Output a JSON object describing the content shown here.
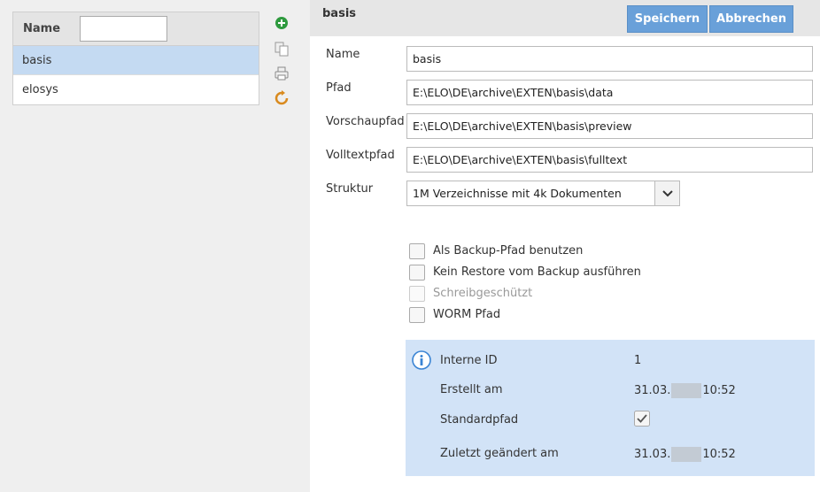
{
  "list": {
    "header_label": "Name",
    "filter_value": "",
    "rows": [
      {
        "label": "basis",
        "selected": true
      },
      {
        "label": "elosys",
        "selected": false
      }
    ]
  },
  "tools": [
    "add-icon",
    "copy-icon",
    "print-icon",
    "refresh-icon"
  ],
  "header": {
    "title": "basis",
    "save_label": "Speichern",
    "cancel_label": "Abbrechen"
  },
  "form": {
    "name_label": "Name",
    "name_value": "basis",
    "pfad_label": "Pfad",
    "pfad_value": "E:\\ELO\\DE\\archive\\EXTEN\\basis\\data",
    "vorschau_label": "Vorschaupfad",
    "vorschau_value": "E:\\ELO\\DE\\archive\\EXTEN\\basis\\preview",
    "volltext_label": "Volltextpfad",
    "volltext_value": "E:\\ELO\\DE\\archive\\EXTEN\\basis\\fulltext",
    "struktur_label": "Struktur",
    "struktur_value": "1M Verzeichnisse mit 4k Dokumenten"
  },
  "checkboxes": [
    {
      "label": "Als Backup-Pfad benutzen",
      "checked": false,
      "disabled": false
    },
    {
      "label": "Kein Restore vom Backup ausführen",
      "checked": false,
      "disabled": false
    },
    {
      "label": "Schreibgeschützt",
      "checked": false,
      "disabled": true
    },
    {
      "label": "WORM Pfad",
      "checked": false,
      "disabled": false
    }
  ],
  "info": {
    "id_label": "Interne ID",
    "id_value": "1",
    "created_label": "Erstellt am",
    "created_date": "31.03.",
    "created_time": "10:52",
    "standard_label": "Standardpfad",
    "standard_checked": true,
    "changed_label": "Zuletzt geändert am",
    "changed_date": "31.03.",
    "changed_time": "10:52"
  },
  "colors": {
    "accent": "#69a0d9",
    "selection": "#c4daf2",
    "info_bg": "#d2e3f7",
    "add_icon": "#2e9a3e",
    "refresh_icon": "#d98a1e"
  }
}
